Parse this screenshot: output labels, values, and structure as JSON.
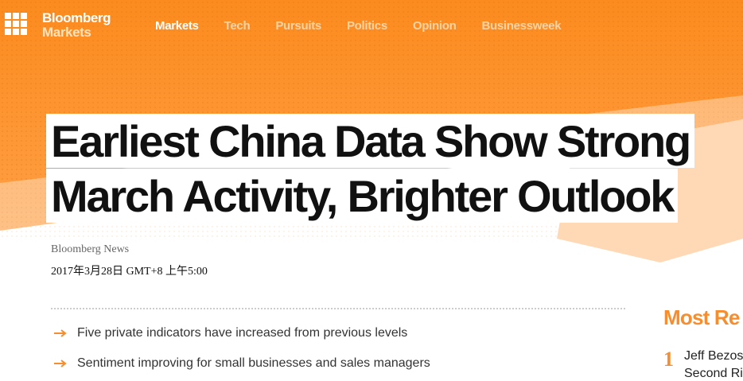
{
  "brand": {
    "line1": "Bloomberg",
    "line2": "Markets",
    "accent_color": "#fb8b1e",
    "accent_light": "#ffa24a"
  },
  "nav": {
    "items": [
      "Markets",
      "Tech",
      "Pursuits",
      "Politics",
      "Opinion",
      "Businessweek"
    ],
    "active": "Markets"
  },
  "article": {
    "headline_line1": "Earliest China Data Show Strong",
    "headline_line2": "March Activity, Brighter Outlook",
    "author": "Bloomberg News",
    "date": "2017年3月28日 GMT+8 上午5:00",
    "bullets": [
      "Five private indicators have increased from previous levels",
      "Sentiment improving for small businesses and sales managers"
    ]
  },
  "most_read": {
    "heading": "Most Re",
    "items": [
      {
        "number": "1",
        "title_line1": "Jeff Bezos",
        "title_line2": "Second Ri"
      }
    ]
  }
}
